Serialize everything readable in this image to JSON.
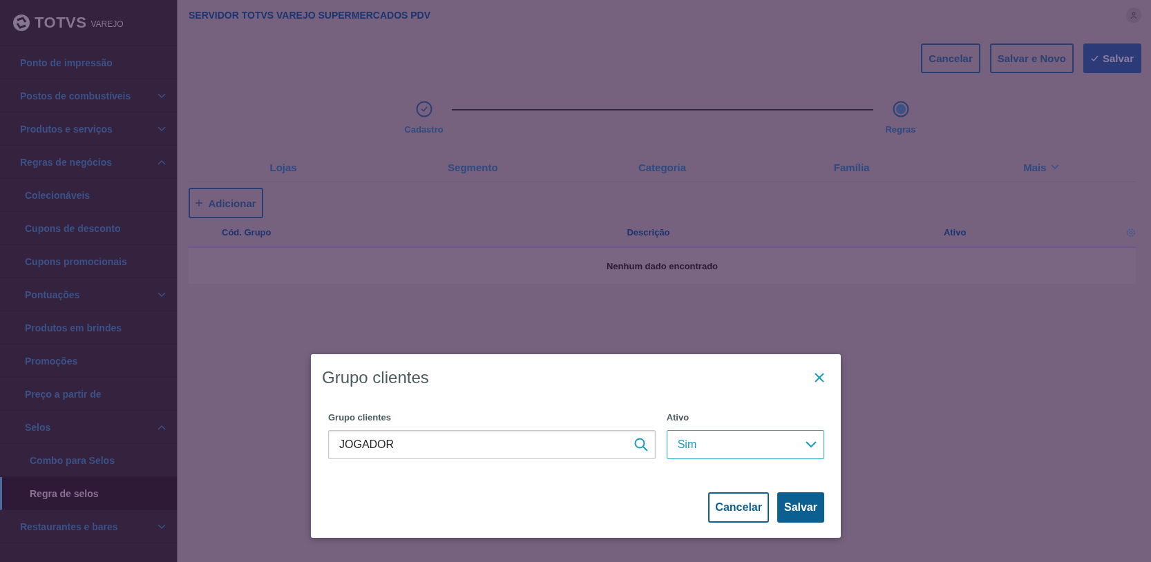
{
  "logo": {
    "brand": "TOTVS",
    "product": "VAREJO"
  },
  "sidebar": {
    "items": [
      {
        "label": "Ponto de impressão",
        "selected": false
      },
      {
        "label": "Postos de combustíveis",
        "selected": false,
        "expanded": false
      },
      {
        "label": "Produtos e serviços",
        "selected": false,
        "expanded": false
      },
      {
        "label": "Regras de negócios",
        "selected": false,
        "expanded": true,
        "children": [
          {
            "label": "Colecionáveis",
            "selected": false
          },
          {
            "label": "Cupons de desconto",
            "selected": false
          },
          {
            "label": "Cupons promocionais",
            "selected": false
          },
          {
            "label": "Pontuações",
            "selected": false,
            "expanded": false
          },
          {
            "label": "Produtos em brindes",
            "selected": false
          },
          {
            "label": "Promoções",
            "selected": false
          },
          {
            "label": "Preço a partir de",
            "selected": false
          },
          {
            "label": "Selos",
            "selected": false,
            "expanded": true,
            "children": [
              {
                "label": "Combo para Selos",
                "selected": false
              },
              {
                "label": "Regra de selos",
                "selected": true
              }
            ]
          }
        ]
      },
      {
        "label": "Restaurantes e bares",
        "selected": false,
        "expanded": false
      }
    ]
  },
  "header": {
    "title": "SERVIDOR TOTVS VAREJO SUPERMERCADOS PDV"
  },
  "actions": [
    {
      "label": "Cancelar",
      "kind": "outline"
    },
    {
      "label": "Salvar e Novo",
      "kind": "outline"
    },
    {
      "label": "Salvar",
      "kind": "primary"
    }
  ],
  "stepper": [
    {
      "label": "Cadastro",
      "completed": true
    },
    {
      "label": "Regras",
      "completed": false
    }
  ],
  "tabs": [
    {
      "label": "Lojas",
      "kind": "tab"
    },
    {
      "label": "Segmento",
      "kind": "tab"
    },
    {
      "label": "Categoria",
      "kind": "tab"
    },
    {
      "label": "Família",
      "kind": "tab"
    },
    {
      "label": "Mais",
      "kind": "more"
    }
  ],
  "add_button": {
    "label": "Adicionar"
  },
  "table": {
    "columns": [
      "Cód. Grupo",
      "Descrição",
      "Ativo"
    ],
    "empty_message": "Nenhum dado encontrado"
  },
  "modal": {
    "title": "Grupo clientes",
    "fields": [
      {
        "label": "Grupo clientes",
        "value": "JOGADOR",
        "kind": "search"
      },
      {
        "label": "Ativo",
        "value": "Sim",
        "kind": "select"
      }
    ],
    "buttons": [
      {
        "label": "Cancelar",
        "kind": "outline"
      },
      {
        "label": "Salvar",
        "kind": "primary"
      }
    ]
  }
}
